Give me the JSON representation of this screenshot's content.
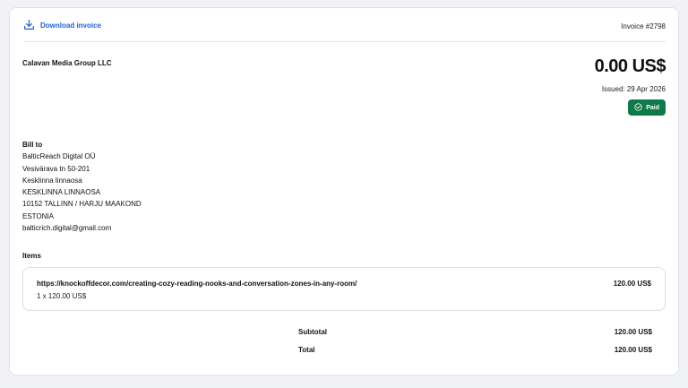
{
  "header": {
    "download_label": "Download invoice",
    "invoice_number": "Invoice #2798"
  },
  "seller": {
    "name": "Calavan Media Group LLC"
  },
  "summary": {
    "amount": "0.00 US$",
    "issued": "Issued: 29 Apr 2026",
    "status": "Paid"
  },
  "bill_to": {
    "heading": "Bill to",
    "lines": [
      "BalticReach Digital OÜ",
      "Vesivärava tn 50-201",
      "Kesklinna linnaosa",
      "KESKLINNA LINNAOSA",
      "10152 TALLINN / HARJU MAAKOND",
      "ESTONIA",
      "balticrich.digital@gmail.com"
    ]
  },
  "items": {
    "heading": "Items",
    "list": [
      {
        "description": "https://knockoffdecor.com/creating-cozy-reading-nooks-and-conversation-zones-in-any-room/",
        "quantity_line": "1 x 120.00 US$",
        "price": "120.00 US$"
      }
    ]
  },
  "totals": {
    "subtotal_label": "Subtotal",
    "subtotal_value": "120.00 US$",
    "total_label": "Total",
    "total_value": "120.00 US$"
  },
  "colors": {
    "accent": "#1f5fd6",
    "paid_badge": "#0e7a4a"
  }
}
